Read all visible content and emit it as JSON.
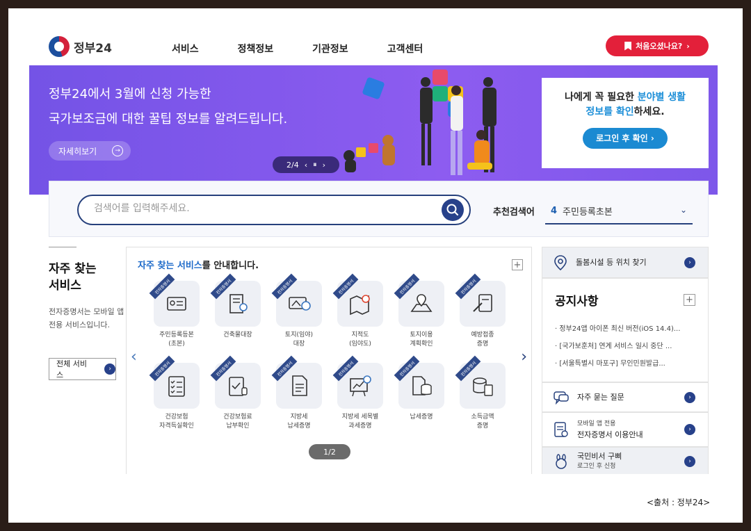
{
  "header": {
    "logo_text": "정부24",
    "nav": [
      "서비스",
      "정책정보",
      "기관정보",
      "고객센터"
    ],
    "first_visit_label": "처음오셨나요?"
  },
  "banner": {
    "line1": "정부24에서 3월에 신청 가능한",
    "line2": "국가보조금에 대한 꿀팁 정보를 알려드립니다.",
    "detail_label": "자세히보기",
    "pager_text": "2/4",
    "login_card": {
      "line1_plain": "나에게 꼭 필요한 ",
      "line1_highlight": "분야별 생활",
      "line2_highlight": "정보를 확인",
      "line2_plain": "하세요.",
      "button_label": "로그인 후 확인"
    }
  },
  "search": {
    "placeholder": "검색어를 입력해주세요.",
    "recommended_label": "추천검색어",
    "recommended_rank": "4",
    "recommended_word": "주민등록초본"
  },
  "favorites": {
    "title": "자주 찾는 서비스",
    "desc": "전자증명서는 모바일 앱 전용 서비스입니다.",
    "all_services_label": "전체 서비스"
  },
  "service_panel": {
    "title_highlight": "자주 찾는 서비스",
    "title_rest": "를 안내합니다.",
    "ribbon_text": "전자증명서",
    "page_indicator": "1/2",
    "items": [
      {
        "label": "주민등록등본\n(초본)",
        "icon": "id-card-icon"
      },
      {
        "label": "건축물대장",
        "icon": "building-search-icon"
      },
      {
        "label": "토지(임야)\n대장",
        "icon": "land-chat-icon"
      },
      {
        "label": "지적도\n(임야도)",
        "icon": "map-pin-icon"
      },
      {
        "label": "토지이용\n계획확인",
        "icon": "map-location-icon"
      },
      {
        "label": "예방접종\n증명",
        "icon": "syringe-doc-icon"
      },
      {
        "label": "건강보험\n자격득실확인",
        "icon": "checklist-icon"
      },
      {
        "label": "건강보험료\n납부확인",
        "icon": "clipboard-stamp-icon"
      },
      {
        "label": "지방세\n납세증명",
        "icon": "document-icon"
      },
      {
        "label": "지방세 세목별\n과세증명",
        "icon": "chart-search-icon"
      },
      {
        "label": "납세증명",
        "icon": "database-doc-icon"
      },
      {
        "label": "소득금액\n증명",
        "icon": "coins-doc-icon"
      }
    ]
  },
  "right_col": {
    "facility_label": "돌봄시설 등 위치 찾기",
    "notice_title": "공지사항",
    "notices": [
      "정부24앱 아이폰 최신 버전(iOS 14.4)...",
      "[국가보훈처] 연계 서비스 일시 중단 ...",
      "[서울특별시 마포구] 무인민원발급..."
    ],
    "faq_label": "자주 묻는 질문",
    "mobile_small": "모바일 앱 전용",
    "mobile_label": "전자증명서 이용안내",
    "secretary_label": "국민비서 구삐",
    "secretary_sub": "로그인 후 신청"
  },
  "source": "<출처 : 정부24>"
}
